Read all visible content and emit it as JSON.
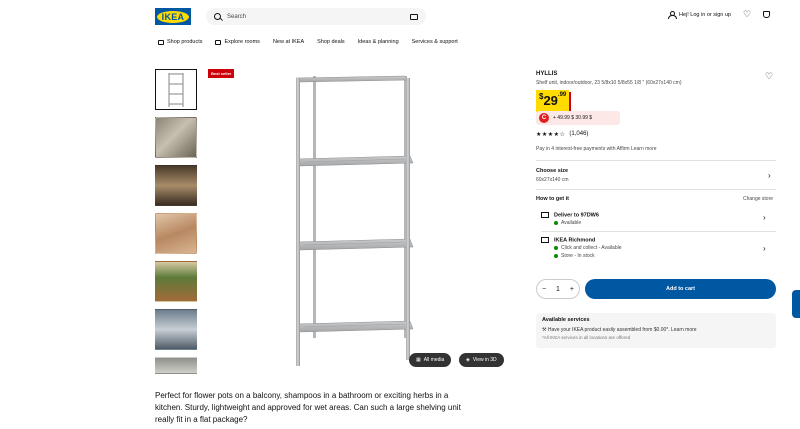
{
  "header": {
    "logo": "IKEA",
    "search_placeholder": "Search",
    "login_label": "Hej! Log in or sign up"
  },
  "nav": [
    "Shop products",
    "Explore rooms",
    "New at IKEA",
    "Shop deals",
    "Ideas & planning",
    "Services & support"
  ],
  "gallery": {
    "badge": "Best seller",
    "all_media": "All media",
    "view_3d": "View in 3D"
  },
  "product": {
    "name": "HYLLIS",
    "description": "Shelf unit, indoor/outdoor, 23 5/8x10 5/8x55 1/8 \" (60x27x140 cm)",
    "price_currency": "$",
    "price_int": "29",
    "price_dec": ".99",
    "promo_text": "+ 49.99 $  30.99 $",
    "rating": 4,
    "stars_text": "★★★★☆",
    "reviews": "(1,046)",
    "pay_text": "Pay in 4 interest-free payments with Affirm Learn more",
    "long_description": "Perfect for flower pots on a balcony, shampoos in a bathroom or exciting herbs in a kitchen. Sturdy, lightweight and approved for wet areas. Can such a large shelving unit really fit in a flat package?"
  },
  "size": {
    "label": "Choose size",
    "value": "60x27x140 cm"
  },
  "how": {
    "label": "How to get it",
    "change_store": "Change store",
    "delivery_title": "Deliver to 97DW6",
    "delivery_status": "Available",
    "store_title": "IKEA Richmond",
    "store_status1": "Click and collect - Available",
    "store_status2": "Store - In stock"
  },
  "purchase": {
    "qty": "1",
    "minus": "−",
    "plus": "+",
    "add_to_cart": "Add to cart"
  },
  "services": {
    "title": "Available services",
    "line1": "Have your IKEA product easily assembled from $0.00*. Learn more",
    "line2": "*All IKEA services in all locations are offered"
  },
  "colors": {
    "brand_blue": "#0058a3",
    "brand_yellow": "#ffdb00",
    "sale_red": "#cc0008",
    "stock_green": "#0a8a00"
  }
}
